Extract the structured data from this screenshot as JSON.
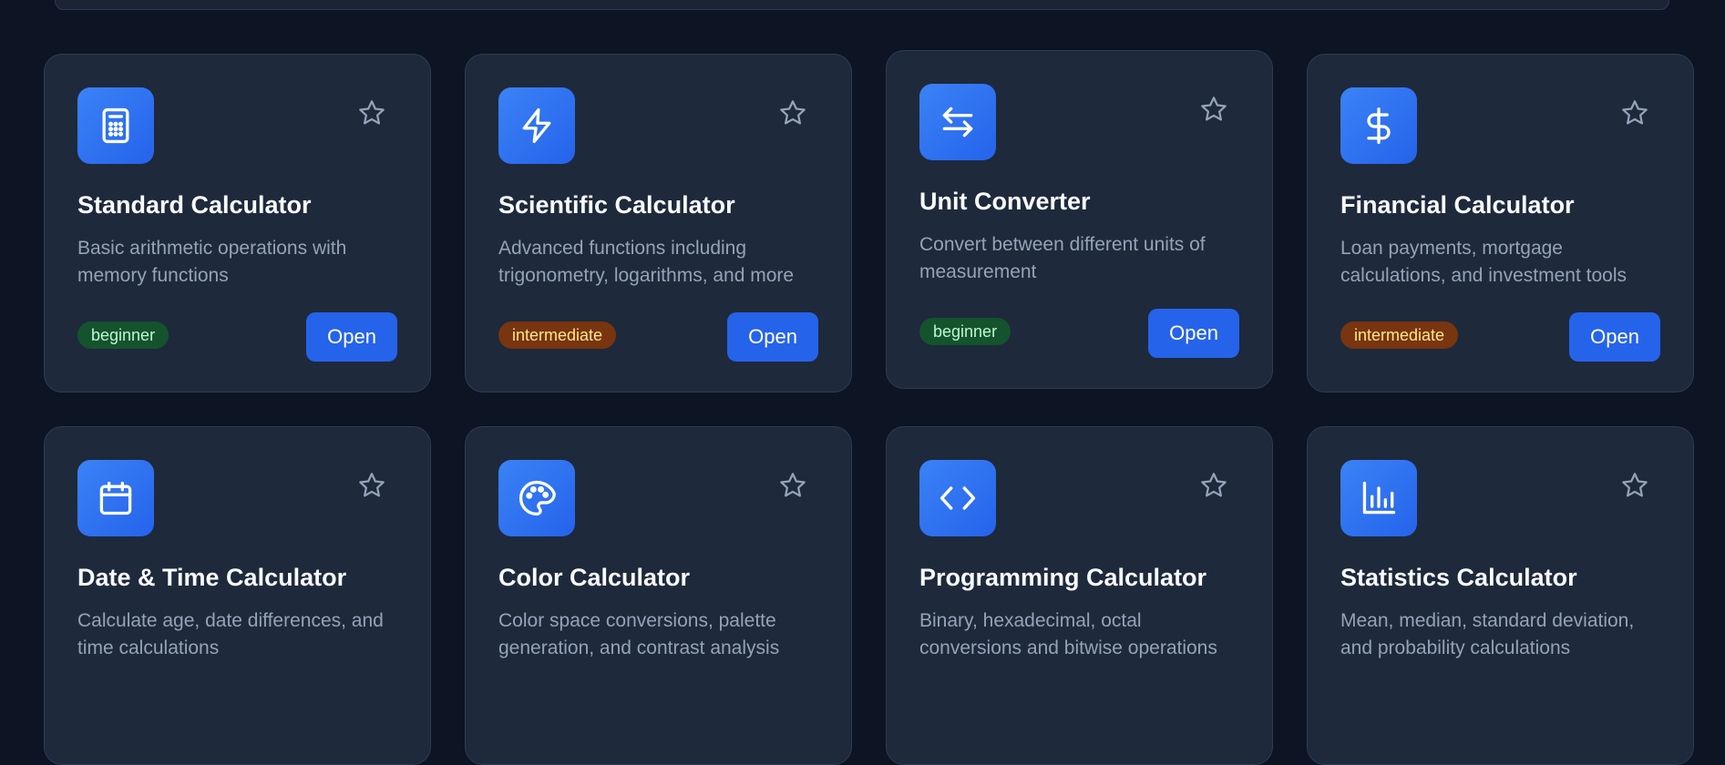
{
  "colors": {
    "background": "#0d1424",
    "card": "#1e293b",
    "accent": "#2563eb",
    "beginner_bg": "#14532d",
    "intermediate_bg": "#78350f"
  },
  "cards": [
    {
      "icon": "calculator-icon",
      "title": "Standard Calculator",
      "description": "Basic arithmetic operations with memory functions",
      "level": "beginner",
      "button": "Open"
    },
    {
      "icon": "lightning-icon",
      "title": "Scientific Calculator",
      "description": "Advanced functions including trigonometry, logarithms, and more",
      "level": "intermediate",
      "button": "Open"
    },
    {
      "icon": "arrows-swap-icon",
      "title": "Unit Converter",
      "description": "Convert between different units of measurement",
      "level": "beginner",
      "button": "Open"
    },
    {
      "icon": "dollar-icon",
      "title": "Financial Calculator",
      "description": "Loan payments, mortgage calculations, and investment tools",
      "level": "intermediate",
      "button": "Open"
    },
    {
      "icon": "calendar-icon",
      "title": "Date & Time Calculator",
      "description": "Calculate age, date differences, and time calculations"
    },
    {
      "icon": "palette-icon",
      "title": "Color Calculator",
      "description": "Color space conversions, palette generation, and contrast analysis"
    },
    {
      "icon": "code-icon",
      "title": "Programming Calculator",
      "description": "Binary, hexadecimal, octal conversions and bitwise operations"
    },
    {
      "icon": "bar-chart-icon",
      "title": "Statistics Calculator",
      "description": "Mean, median, standard deviation, and probability calculations"
    }
  ]
}
